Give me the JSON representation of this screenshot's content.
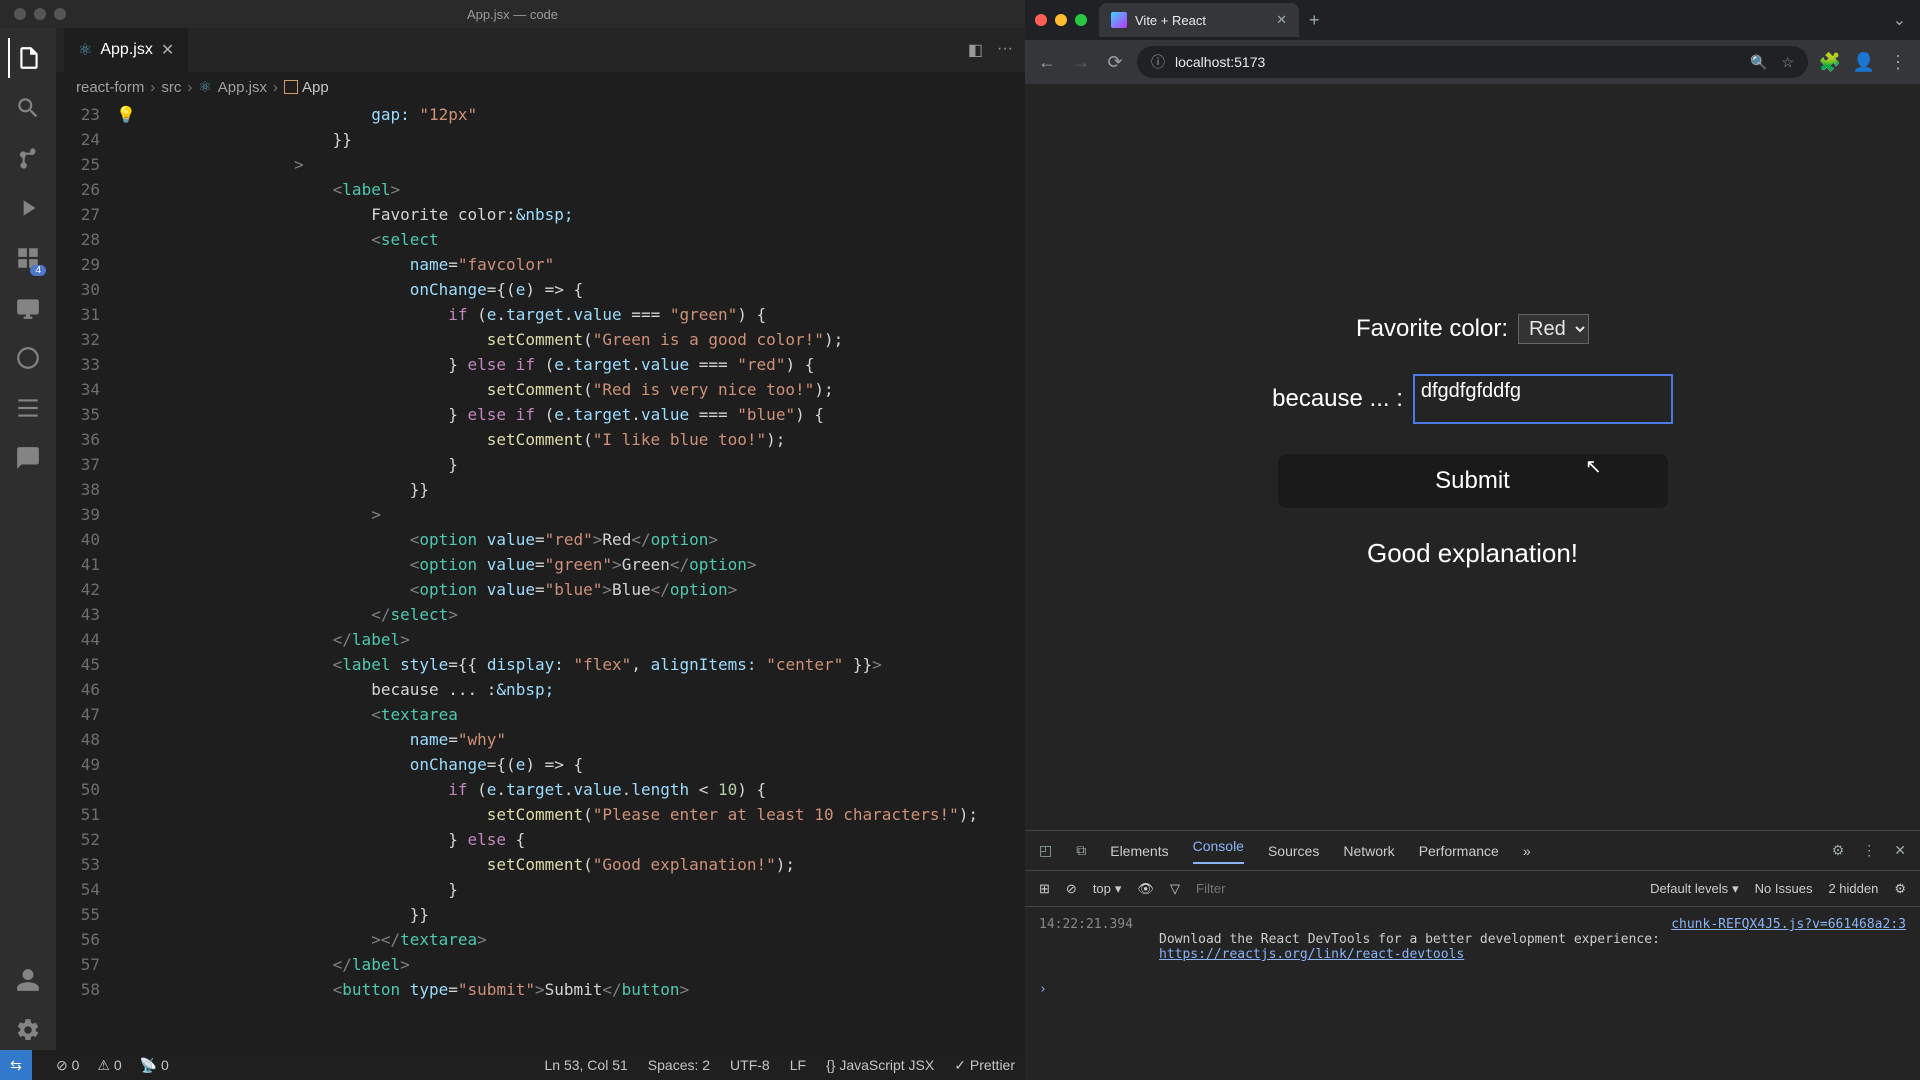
{
  "vscode": {
    "title": "App.jsx — code",
    "activity_badge": "4",
    "tab": {
      "icon": "⚛",
      "filename": "App.jsx"
    },
    "split_icon": "▢▢",
    "more_icon": "···",
    "breadcrumb": {
      "parts": [
        "react-form",
        "src",
        "App.jsx"
      ],
      "symbol": "App"
    },
    "code": [
      {
        "n": 23,
        "html": "                        <span class='c-prop'>gap:</span> <span class='c-str'>\"12px\"</span>"
      },
      {
        "n": 24,
        "html": "                    <span class='c-op'>}}</span>"
      },
      {
        "n": 25,
        "html": "                <span class='c-ang'>&gt;</span>"
      },
      {
        "n": 26,
        "html": "                    <span class='c-ang'>&lt;</span><span class='c-tag'>label</span><span class='c-ang'>&gt;</span>"
      },
      {
        "n": 27,
        "html": "                        <span class='c-txt'>Favorite color:</span><span class='c-attr'>&amp;nbsp;</span>"
      },
      {
        "n": 28,
        "html": "                        <span class='c-ang'>&lt;</span><span class='c-tag'>select</span>"
      },
      {
        "n": 29,
        "html": "                            <span class='c-attr'>name</span>=<span class='c-str'>\"favcolor\"</span>"
      },
      {
        "n": 30,
        "html": "                            <span class='c-attr'>onChange</span>={(<span class='c-var'>e</span>) <span class='c-op'>=&gt;</span> {"
      },
      {
        "n": 31,
        "html": "                                <span class='c-kw'>if</span> (<span class='c-var'>e</span>.<span class='c-prop'>target</span>.<span class='c-prop'>value</span> === <span class='c-str'>\"green\"</span>) {"
      },
      {
        "n": 32,
        "html": "                                    <span class='c-fn'>setComment</span>(<span class='c-str'>\"Green is a good color!\"</span>);"
      },
      {
        "n": 33,
        "html": "                                } <span class='c-kw'>else if</span> (<span class='c-var'>e</span>.<span class='c-prop'>target</span>.<span class='c-prop'>value</span> === <span class='c-str'>\"red\"</span>) {"
      },
      {
        "n": 34,
        "html": "                                    <span class='c-fn'>setComment</span>(<span class='c-str'>\"Red is very nice too!\"</span>);"
      },
      {
        "n": 35,
        "html": "                                } <span class='c-kw'>else if</span> (<span class='c-var'>e</span>.<span class='c-prop'>target</span>.<span class='c-prop'>value</span> === <span class='c-str'>\"blue\"</span>) {"
      },
      {
        "n": 36,
        "html": "                                    <span class='c-fn'>setComment</span>(<span class='c-str'>\"I like blue too!\"</span>);"
      },
      {
        "n": 37,
        "html": "                                }"
      },
      {
        "n": 38,
        "html": "                            }}"
      },
      {
        "n": 39,
        "html": "                        <span class='c-ang'>&gt;</span>"
      },
      {
        "n": 40,
        "html": "                            <span class='c-ang'>&lt;</span><span class='c-tag'>option</span> <span class='c-attr'>value</span>=<span class='c-str'>\"red\"</span><span class='c-ang'>&gt;</span>Red<span class='c-ang'>&lt;/</span><span class='c-tag'>option</span><span class='c-ang'>&gt;</span>"
      },
      {
        "n": 41,
        "html": "                            <span class='c-ang'>&lt;</span><span class='c-tag'>option</span> <span class='c-attr'>value</span>=<span class='c-str'>\"green\"</span><span class='c-ang'>&gt;</span>Green<span class='c-ang'>&lt;/</span><span class='c-tag'>option</span><span class='c-ang'>&gt;</span>"
      },
      {
        "n": 42,
        "html": "                            <span class='c-ang'>&lt;</span><span class='c-tag'>option</span> <span class='c-attr'>value</span>=<span class='c-str'>\"blue\"</span><span class='c-ang'>&gt;</span>Blue<span class='c-ang'>&lt;/</span><span class='c-tag'>option</span><span class='c-ang'>&gt;</span>"
      },
      {
        "n": 43,
        "html": "                        <span class='c-ang'>&lt;/</span><span class='c-tag'>select</span><span class='c-ang'>&gt;</span>"
      },
      {
        "n": 44,
        "html": "                    <span class='c-ang'>&lt;/</span><span class='c-tag'>label</span><span class='c-ang'>&gt;</span>"
      },
      {
        "n": 45,
        "html": "                    <span class='c-ang'>&lt;</span><span class='c-tag'>label</span> <span class='c-attr'>style</span>={{ <span class='c-prop'>display:</span> <span class='c-str'>\"flex\"</span>, <span class='c-prop'>alignItems:</span> <span class='c-str'>\"center\"</span> }}<span class='c-ang'>&gt;</span>"
      },
      {
        "n": 46,
        "html": "                        <span class='c-txt'>because ... :</span><span class='c-attr'>&amp;nbsp;</span>"
      },
      {
        "n": 47,
        "html": "                        <span class='c-ang'>&lt;</span><span class='c-tag'>textarea</span>"
      },
      {
        "n": 48,
        "html": "                            <span class='c-attr'>name</span>=<span class='c-str'>\"why\"</span>"
      },
      {
        "n": 49,
        "html": "                            <span class='c-attr'>onChange</span>={(<span class='c-var'>e</span>) <span class='c-op'>=&gt;</span> {"
      },
      {
        "n": 50,
        "html": "                                <span class='c-kw'>if</span> (<span class='c-var'>e</span>.<span class='c-prop'>target</span>.<span class='c-prop'>value</span>.<span class='c-prop'>length</span> &lt; <span class='c-num'>10</span>) {"
      },
      {
        "n": 51,
        "html": "                                    <span class='c-fn'>setComment</span>(<span class='c-str'>\"Please enter at least 10 characters!\"</span>);"
      },
      {
        "n": 52,
        "html": "                                } <span class='c-kw'>else</span> {"
      },
      {
        "n": 53,
        "glyph": "💡",
        "html": "                                    <span class='c-fn'>setComment</span>(<span class='c-str'>\"Good explanation!\"</span>);"
      },
      {
        "n": 54,
        "html": "                                }"
      },
      {
        "n": 55,
        "html": "                            }}"
      },
      {
        "n": 56,
        "html": "                        <span class='c-ang'>&gt;&lt;/</span><span class='c-tag'>textarea</span><span class='c-ang'>&gt;</span>"
      },
      {
        "n": 57,
        "html": "                    <span class='c-ang'>&lt;/</span><span class='c-tag'>label</span><span class='c-ang'>&gt;</span>"
      },
      {
        "n": 58,
        "html": "                    <span class='c-ang'>&lt;</span><span class='c-tag'>button</span> <span class='c-attr'>type</span>=<span class='c-str'>\"submit\"</span><span class='c-ang'>&gt;</span>Submit<span class='c-ang'>&lt;/</span><span class='c-tag'>button</span><span class='c-ang'>&gt;</span>"
      }
    ],
    "status": {
      "errors": "0",
      "warnings": "0",
      "ports": "0",
      "cursor": "Ln 53, Col 51",
      "spaces": "Spaces: 2",
      "encoding": "UTF-8",
      "eol": "LF",
      "lang": "JavaScript JSX",
      "prettier": "Prettier"
    }
  },
  "browser": {
    "tab_title": "Vite + React",
    "url": "localhost:5173",
    "form": {
      "label_color": "Favorite color:",
      "selected": "Red",
      "label_because": "because ... :",
      "textarea_value": "dfgdfgfddfg",
      "submit": "Submit",
      "message": "Good explanation!"
    },
    "devtools": {
      "tabs": [
        "Elements",
        "Console",
        "Sources",
        "Network",
        "Performance"
      ],
      "active_tab": "Console",
      "more": "»",
      "context": "top",
      "filter_placeholder": "Filter",
      "levels": "Default levels",
      "issues": "No Issues",
      "hidden": "2 hidden",
      "log": {
        "ts": "14:22:21.394",
        "src": "chunk-REFQX4J5.js?v=661468a2:3",
        "text": "Download the React DevTools for a better development experience:",
        "link": "https://reactjs.org/link/react-devtools"
      }
    }
  }
}
